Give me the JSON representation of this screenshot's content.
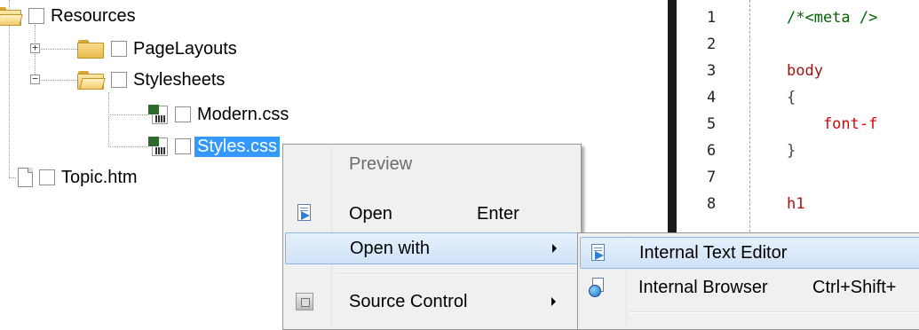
{
  "tree": {
    "items": [
      {
        "label": "Resources"
      },
      {
        "label": "PageLayouts"
      },
      {
        "label": "Stylesheets"
      },
      {
        "label": "Modern.css"
      },
      {
        "label": "Styles.css"
      },
      {
        "label": "Topic.htm"
      }
    ]
  },
  "editor": {
    "line_numbers": [
      "1",
      "2",
      "3",
      "4",
      "5",
      "6",
      "7",
      "8"
    ],
    "lines": [
      "/*<meta />",
      "",
      "body",
      "{",
      "    font-f",
      "}",
      "",
      "h1"
    ],
    "colors": {
      "keyword": "#a31515",
      "comment": "#006400"
    }
  },
  "context_menu": {
    "items": [
      {
        "label": "Preview",
        "state": "disabled"
      },
      {
        "label": "Open",
        "shortcut": "Enter",
        "icon": "text-editor-icon"
      },
      {
        "label": "Open with",
        "state": "highlighted",
        "submenu": true
      },
      {
        "label": "Source Control",
        "submenu": true,
        "icon": "source-control-icon"
      }
    ]
  },
  "submenu": {
    "items": [
      {
        "label": "Internal Text Editor",
        "state": "highlighted",
        "icon": "text-editor-icon"
      },
      {
        "label": "Internal Browser",
        "shortcut": "Ctrl+Shift+",
        "icon": "browser-icon"
      }
    ]
  },
  "colors": {
    "selection": "#3399ff",
    "menu_bg": "#f0f0f0",
    "menu_highlight": "#cfe2f7",
    "divider": "#1b1b1b"
  }
}
